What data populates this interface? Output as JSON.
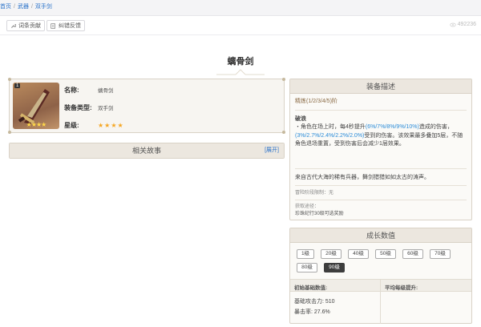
{
  "breadcrumb": {
    "home": "首页",
    "weapon": "武器",
    "current": "双手剑"
  },
  "toolbar": {
    "contribute": "词条贡献",
    "feedback": "纠错反馈",
    "views": "492236"
  },
  "page_title": "螭骨剑",
  "infobox": {
    "badge": "1",
    "name_label": "名称:",
    "name_value": "螭骨剑",
    "type_label": "装备类型:",
    "type_value": "双手剑",
    "rarity_label": "星级:",
    "rarity_stars": "★★★★",
    "card_stars": "★★★★"
  },
  "story": {
    "title": "相关故事",
    "expand": "[展开]"
  },
  "desc": {
    "title": "装备描述",
    "refine": "精炼(1/2/3/4/5)阶",
    "skill_name": "破浪",
    "text_a": "・角色在场上时，每4秒提升",
    "hl_a": "(6%/7%/8%/9%/10%)",
    "text_b": "造成的伤害，",
    "hl_b": "(3%/2.7%/2.4%/2.2%/2.0%)",
    "text_c": "受到的伤害。该效果最多叠加5层，不随角色退场重置，受到伤害后会减少1层效果。",
    "lore": "来自古代大海的稀有兵器，舞剑猎猎如如太古的涛声。",
    "limit_label": "冒险阶段限制：无",
    "source_label": "获取途径：",
    "source_value": "珍珠纪行30级可选奖励"
  },
  "growth": {
    "title": "成长数值",
    "levels": [
      "1级",
      "20级",
      "40级",
      "50级",
      "60级",
      "70级",
      "80级",
      "90级"
    ],
    "selected": "90级",
    "col_base": "初始基础数值:",
    "col_avg": "平均每级提升:",
    "atk": "基础攻击力: 510",
    "crit": "暴击率: 27.6%"
  }
}
